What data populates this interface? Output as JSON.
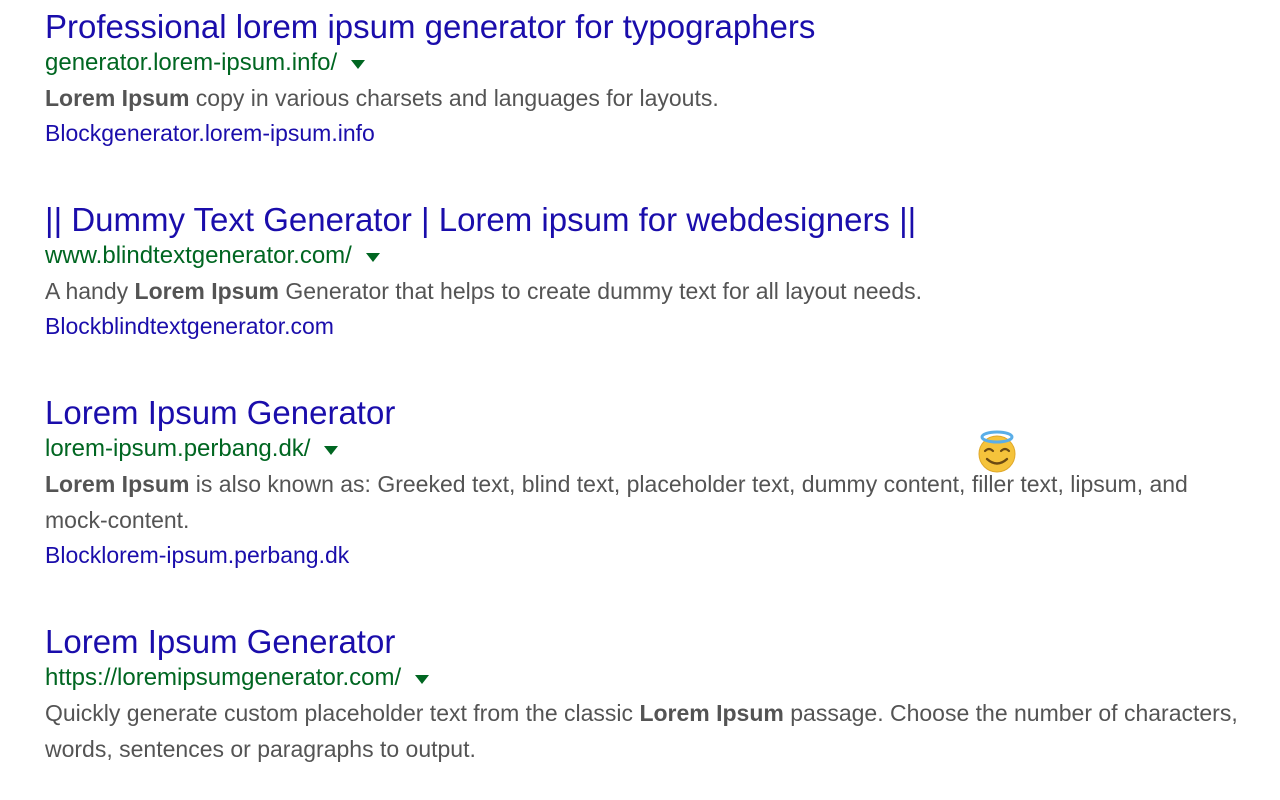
{
  "results": [
    {
      "title": "Professional lorem ipsum generator for typographers",
      "url": "generator.lorem-ipsum.info/",
      "snippet": {
        "before": "",
        "bold": "Lorem Ipsum",
        "after": " copy in various charsets and languages for layouts."
      },
      "block_link": "Blockgenerator.lorem-ipsum.info"
    },
    {
      "title": "|| Dummy Text Generator | Lorem ipsum for webdesigners ||",
      "url": "www.blindtextgenerator.com/",
      "snippet": {
        "before": "A handy ",
        "bold": "Lorem Ipsum",
        "after": " Generator that helps to create dummy text for all layout needs."
      },
      "block_link": "Blockblindtextgenerator.com"
    },
    {
      "title": "Lorem Ipsum Generator",
      "url": "lorem-ipsum.perbang.dk/",
      "snippet": {
        "before": "",
        "bold": "Lorem Ipsum",
        "after": " is also known as: Greeked text, blind text, placeholder text, dummy content, filler text, lipsum, and mock-content."
      },
      "block_link": "Blocklorem-ipsum.perbang.dk"
    },
    {
      "title": "Lorem Ipsum Generator",
      "url": "https://loremipsumgenerator.com/",
      "snippet": {
        "before": "Quickly generate custom placeholder text from the classic ",
        "bold": "Lorem Ipsum",
        "after": " passage. Choose the number of characters, words, sentences or paragraphs to output."
      }
    }
  ],
  "emoji_icon": "smiling-face-with-halo-icon",
  "colors": {
    "title_link": "#1a0dab",
    "url": "#006621",
    "snippet_text": "#545454",
    "emoji_face": "#f5c33b",
    "emoji_halo": "#5aaee8"
  }
}
